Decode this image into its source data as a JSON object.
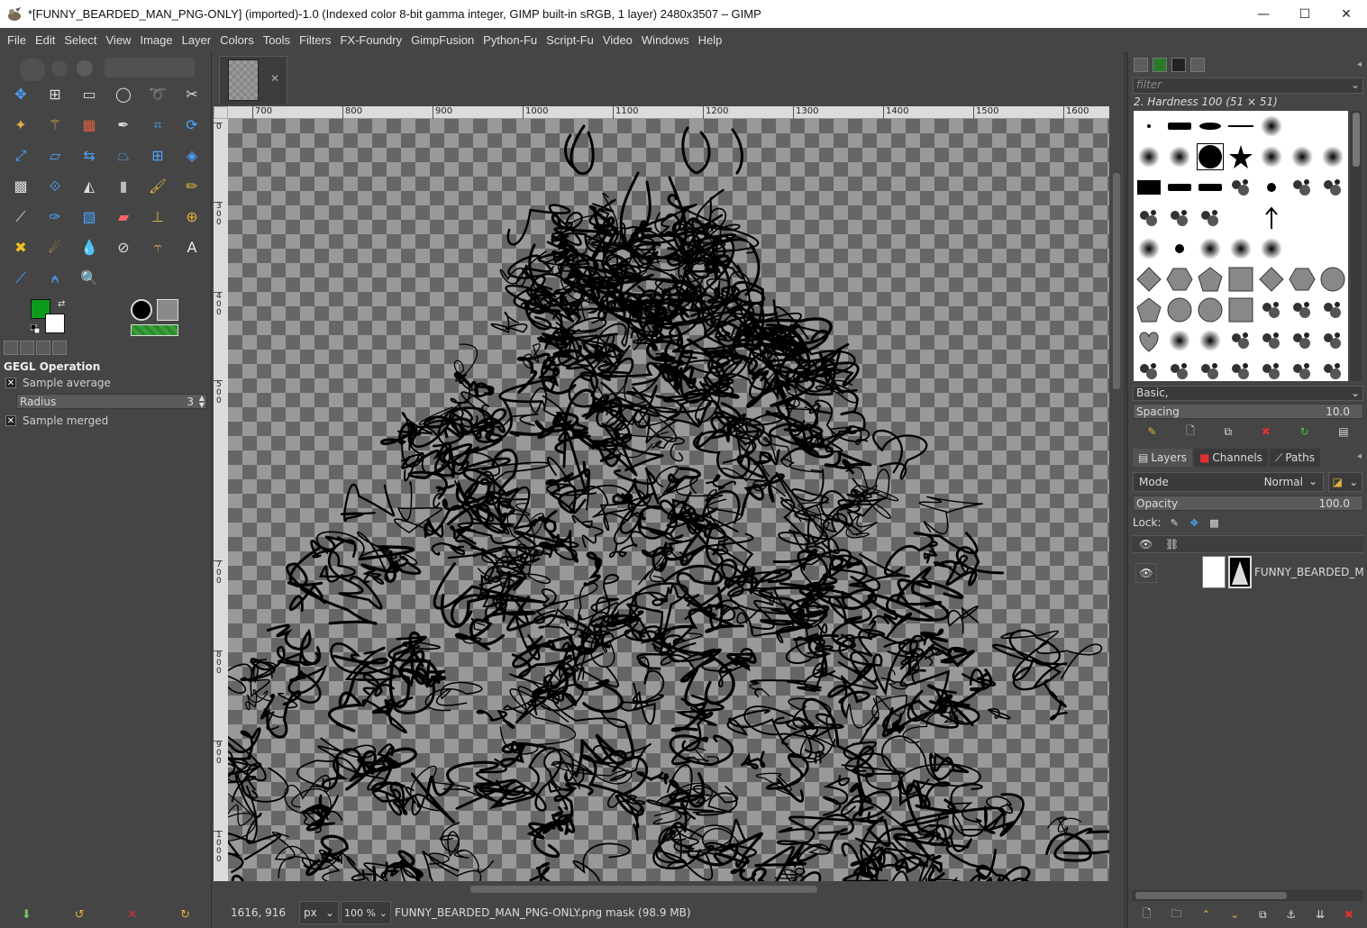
{
  "window": {
    "title": "*[FUNNY_BEARDED_MAN_PNG-ONLY] (imported)-1.0 (Indexed color 8-bit gamma integer, GIMP built-in sRGB, 1 layer) 2480x3507 – GIMP",
    "minimize": "—",
    "maximize": "☐",
    "close": "✕"
  },
  "menu": [
    "File",
    "Edit",
    "Select",
    "View",
    "Image",
    "Layer",
    "Colors",
    "Tools",
    "Filters",
    "FX-Foundry",
    "GimpFusion",
    "Python-Fu",
    "Script-Fu",
    "Video",
    "Windows",
    "Help"
  ],
  "tools": [
    {
      "name": "move-tool-icon",
      "glyph": "✥",
      "color": "#4aa3ff"
    },
    {
      "name": "alignment-tool-icon",
      "glyph": "⊞",
      "color": "#dddddd"
    },
    {
      "name": "rect-select-icon",
      "glyph": "▭",
      "color": "#dddddd"
    },
    {
      "name": "ellipse-select-icon",
      "glyph": "◯",
      "color": "#dddddd"
    },
    {
      "name": "free-select-icon",
      "glyph": "➰",
      "color": "#dddddd"
    },
    {
      "name": "scissors-select-icon",
      "glyph": "✂",
      "color": "#dddddd"
    },
    {
      "name": "foreground-select-icon",
      "glyph": "✦",
      "color": "#e0b040"
    },
    {
      "name": "fuzzy-select-icon",
      "glyph": "⚚",
      "color": "#e0b040"
    },
    {
      "name": "color-select-icon",
      "glyph": "▦",
      "color": "#e06040"
    },
    {
      "name": "paths-tool-icon",
      "glyph": "✒",
      "color": "#dddddd"
    },
    {
      "name": "crop-tool-icon",
      "glyph": "⌗",
      "color": "#4aa3ff"
    },
    {
      "name": "transform-tool-icon",
      "glyph": "⟳",
      "color": "#4aa3ff"
    },
    {
      "name": "scale-tool-icon",
      "glyph": "⤢",
      "color": "#4aa3ff"
    },
    {
      "name": "shear-tool-icon",
      "glyph": "▱",
      "color": "#4aa3ff"
    },
    {
      "name": "flip-tool-icon",
      "glyph": "⇆",
      "color": "#4aa3ff"
    },
    {
      "name": "perspective-tool-icon",
      "glyph": "⏢",
      "color": "#4aa3ff"
    },
    {
      "name": "cage-tool-icon",
      "glyph": "⊞",
      "color": "#4aa3ff"
    },
    {
      "name": "warp-tool-icon",
      "glyph": "◈",
      "color": "#4aa3ff"
    },
    {
      "name": "checker-icon",
      "glyph": "▩",
      "color": "#dddddd"
    },
    {
      "name": "handle-transform-icon",
      "glyph": "⟐",
      "color": "#4aa3ff"
    },
    {
      "name": "bucket-fill-icon",
      "glyph": "◭",
      "color": "#dddddd"
    },
    {
      "name": "gradient-tool-icon",
      "glyph": "▮",
      "color": "#bbbbbb"
    },
    {
      "name": "paintbrush-icon",
      "glyph": "🖌",
      "color": "#e0b040"
    },
    {
      "name": "pencil-icon",
      "glyph": "✏",
      "color": "#e0b040"
    },
    {
      "name": "airbrush-icon",
      "glyph": "⟋",
      "color": "#dddddd"
    },
    {
      "name": "ink-tool-icon",
      "glyph": "✑",
      "color": "#4aa3ff"
    },
    {
      "name": "mypaint-brush-icon",
      "glyph": "▧",
      "color": "#4aa3ff"
    },
    {
      "name": "eraser-icon",
      "glyph": "▰",
      "color": "#ff6666"
    },
    {
      "name": "clone-tool-icon",
      "glyph": "⊥",
      "color": "#e0b040"
    },
    {
      "name": "heal-tool-icon",
      "glyph": "⊕",
      "color": "#e0b040"
    },
    {
      "name": "heal-cross-icon",
      "glyph": "✖",
      "color": "#f0c020"
    },
    {
      "name": "smudge-tool-icon",
      "glyph": "☄",
      "color": "#e0b040"
    },
    {
      "name": "blur-tool-icon",
      "glyph": "💧",
      "color": "#4aa3ff"
    },
    {
      "name": "dodge-burn-icon",
      "glyph": "⊘",
      "color": "#dddddd"
    },
    {
      "name": "measure-tool-icon",
      "glyph": "⥾",
      "color": "#e0b040"
    },
    {
      "name": "text-tool-icon",
      "glyph": "A",
      "color": "#eeeeee"
    },
    {
      "name": "color-picker-icon",
      "glyph": "⟋",
      "color": "#4aa3ff"
    },
    {
      "name": "compass-tool-icon",
      "glyph": "⍲",
      "color": "#4aa3ff"
    },
    {
      "name": "zoom-tool-icon",
      "glyph": "🔍",
      "color": "#4aa3ff"
    }
  ],
  "tool_options": {
    "title": "GEGL Operation",
    "sample_average": "Sample average",
    "radius_label": "Radius",
    "radius_value": "3",
    "sample_merged": "Sample merged"
  },
  "image_tab": {
    "close": "✕"
  },
  "ruler_h": [
    "700",
    "800",
    "900",
    "1000",
    "1100",
    "1200",
    "1300",
    "1400",
    "1500",
    "1600"
  ],
  "ruler_v": [
    "0",
    "300",
    "400",
    "500",
    "700",
    "800",
    "900",
    "1000"
  ],
  "status": {
    "coords": "1616, 916",
    "unit": "px",
    "zoom": "100 %",
    "message": "FUNNY_BEARDED_MAN_PNG-ONLY.png mask (98.9 MB)"
  },
  "brushes": {
    "filter_placeholder": "filter",
    "selected_name": "2. Hardness 100 (51 × 51)",
    "preset": "Basic,",
    "spacing_label": "Spacing",
    "spacing_value": "10.0"
  },
  "layers": {
    "tab_layers": "Layers",
    "tab_channels": "Channels",
    "tab_paths": "Paths",
    "mode_label": "Mode",
    "mode_value": "Normal",
    "opacity_label": "Opacity",
    "opacity_value": "100.0",
    "lock_label": "Lock:",
    "layer_name": "FUNNY_BEARDED_MAN_PNG-ONLY.png"
  },
  "colors": {
    "foreground": "#0c9a1d",
    "background": "#ffffff"
  }
}
